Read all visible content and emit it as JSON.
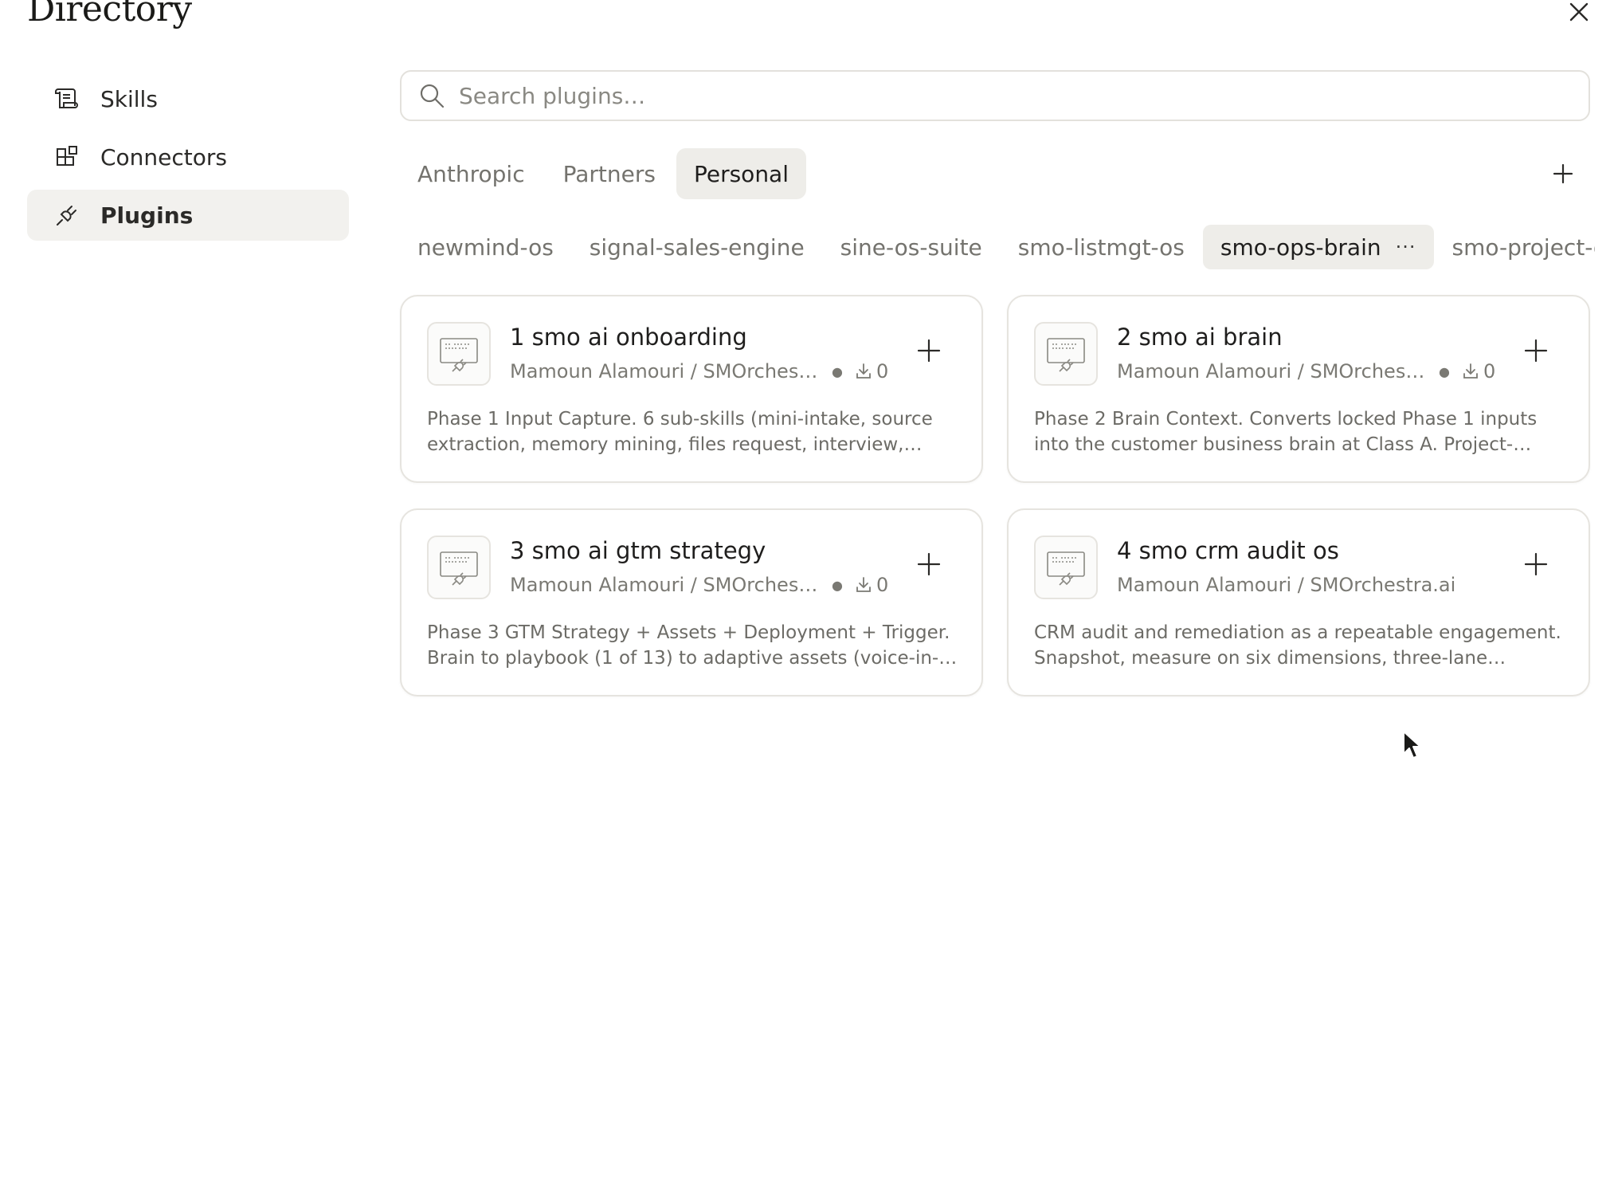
{
  "header": {
    "title": "Directory"
  },
  "sidebar": {
    "items": [
      {
        "label": "Skills",
        "icon": "scroll-icon"
      },
      {
        "label": "Connectors",
        "icon": "grid-blocks-icon"
      },
      {
        "label": "Plugins",
        "icon": "plug-icon",
        "active": true
      }
    ]
  },
  "search": {
    "placeholder": "Search plugins…",
    "value": ""
  },
  "tabs": [
    {
      "label": "Anthropic"
    },
    {
      "label": "Partners"
    },
    {
      "label": "Personal",
      "active": true
    }
  ],
  "marketplaces": [
    {
      "label": "newmind-os"
    },
    {
      "label": "signal-sales-engine"
    },
    {
      "label": "sine-os-suite"
    },
    {
      "label": "smo-listmgt-os"
    },
    {
      "label": "smo-ops-brain",
      "active": true,
      "more": "···"
    },
    {
      "label": "smo-project-os"
    }
  ],
  "cards": [
    {
      "title": "1 smo ai onboarding",
      "author": "Mamoun Alamouri / SMOrchestr…",
      "downloads": "0",
      "description": "Phase 1 Input Capture. 6 sub-skills (mini-intake, source extraction, memory mining, files request, interview,…"
    },
    {
      "title": "2 smo ai brain",
      "author": "Mamoun Alamouri / SMOrchestr…",
      "downloads": "0",
      "description": "Phase 2 Brain Context. Converts locked Phase 1 inputs into the customer business brain at Class A. Project-level…"
    },
    {
      "title": "3 smo ai gtm strategy",
      "author": "Mamoun Alamouri / SMOrchestr…",
      "downloads": "0",
      "description": "Phase 3 GTM Strategy + Assets + Deployment + Trigger. Brain to playbook (1 of 13) to adaptive assets (voice-in-…"
    },
    {
      "title": "4 smo crm audit os",
      "author": "Mamoun Alamouri / SMOrchestra.ai",
      "downloads": null,
      "description": "CRM audit and remediation as a repeatable engagement. Snapshot, measure on six dimensions, three-lane action…"
    }
  ]
}
